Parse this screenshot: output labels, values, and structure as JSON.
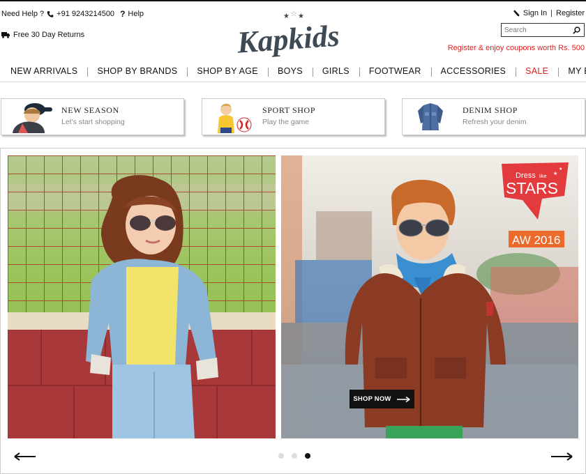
{
  "header": {
    "help_label": "Need Help ?",
    "phone": "+91 9243214500",
    "help_link": "Help",
    "returns": "Free 30 Day Returns",
    "logo_text": "Kapkids",
    "sign_in": "Sign In",
    "separator": "|",
    "register": "Register",
    "search_placeholder": "Search",
    "promo": "Register & enjoy coupons worth Rs. 500"
  },
  "nav": {
    "items": [
      {
        "label": "NEW ARRIVALS"
      },
      {
        "label": "SHOP BY BRANDS"
      },
      {
        "label": "SHOP BY AGE"
      },
      {
        "label": "BOYS"
      },
      {
        "label": "GIRLS"
      },
      {
        "label": "FOOTWEAR"
      },
      {
        "label": "ACCESSORIES"
      },
      {
        "label": "SALE"
      },
      {
        "label": "MY BAG"
      }
    ]
  },
  "tiles": [
    {
      "title": "NEW SEASON",
      "subtitle": "Let's start shopping"
    },
    {
      "title": "SPORT SHOP",
      "subtitle": "Play the game"
    },
    {
      "title": "DENIM SHOP",
      "subtitle": "Refresh your denim"
    }
  ],
  "slider": {
    "badge_line1": "Dress",
    "badge_line2": "like",
    "badge_line3": "STARS",
    "badge_season": "AW 2016",
    "cta": "SHOP NOW",
    "slide_count": 3,
    "active_slide": 3
  },
  "colors": {
    "accent_red": "#e02020",
    "badge_red": "#e33a3d",
    "badge_orange": "#ec6a2c"
  }
}
